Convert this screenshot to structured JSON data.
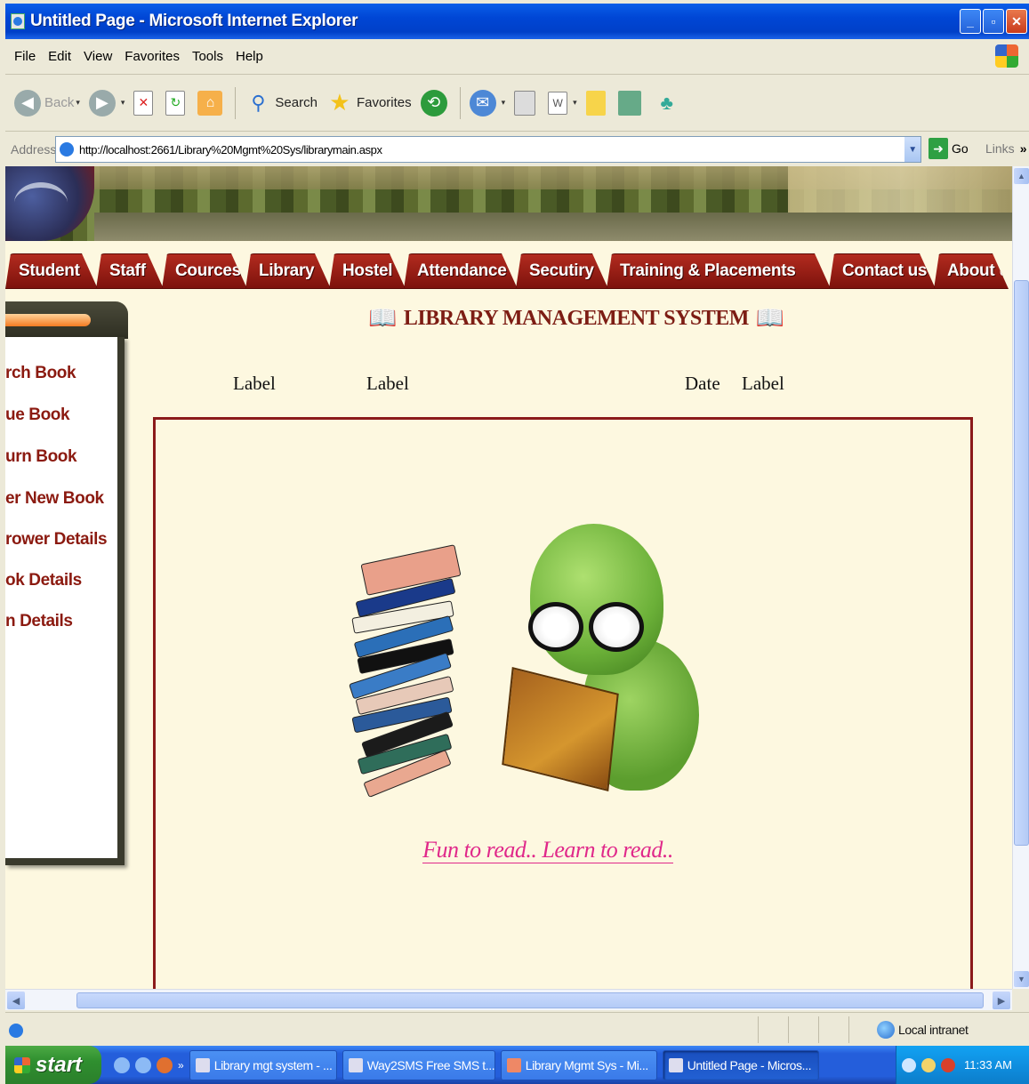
{
  "window": {
    "title": "Untitled Page - Microsoft Internet Explorer",
    "controls": [
      "minimize",
      "maximize",
      "close"
    ]
  },
  "menu": [
    "File",
    "Edit",
    "View",
    "Favorites",
    "Tools",
    "Help"
  ],
  "toolbar": {
    "back": "Back",
    "search": "Search",
    "favorites": "Favorites"
  },
  "address": {
    "label": "Address",
    "url": "http://localhost:2661/Library%20Mgmt%20Sys/librarymain.aspx",
    "go": "Go",
    "links": "Links",
    "more": "»"
  },
  "site": {
    "nav_tabs": [
      "Student",
      "Staff",
      "Cources",
      "Library",
      "Hostel",
      "Attendance",
      "Secutiry",
      "Training & Placements",
      "Contact us",
      "About us"
    ],
    "side_links": [
      "rch Book",
      "ue Book",
      "urn Book",
      "er New Book",
      "rower Details",
      "ok Details",
      "n Details"
    ],
    "heading": "LIBRARY MANAGEMENT SYSTEM",
    "labels": [
      "Label",
      "Label",
      "Date",
      "Label"
    ],
    "tagline": "Fun to read.. Learn to read.."
  },
  "status": {
    "zone": "Local intranet"
  },
  "taskbar": {
    "start": "start",
    "tasks": [
      {
        "label": "Library mgt system - ...",
        "active": false
      },
      {
        "label": "Way2SMS Free SMS t...",
        "active": false
      },
      {
        "label": "Library Mgmt Sys - Mi...",
        "active": false
      },
      {
        "label": "Untitled Page - Micros...",
        "active": true
      }
    ],
    "clock": "11:33 AM"
  },
  "colors": {
    "xp_blue": "#0046d5",
    "tab_red": "#9a1f14",
    "page_bg": "#fdf8e0",
    "tagline": "#e0288a"
  }
}
